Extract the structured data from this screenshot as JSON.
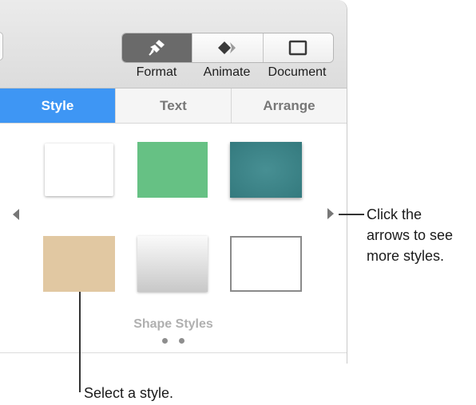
{
  "toolbar": {
    "buttons": [
      {
        "label": "Format",
        "icon": "paintbrush-icon",
        "active": true
      },
      {
        "label": "Animate",
        "icon": "diamond-arrow-icon",
        "active": false
      },
      {
        "label": "Document",
        "icon": "document-rect-icon",
        "active": false
      }
    ]
  },
  "tabs": [
    {
      "label": "Style",
      "active": true
    },
    {
      "label": "Text",
      "active": false
    },
    {
      "label": "Arrange",
      "active": false
    }
  ],
  "styles": {
    "swatches": [
      {
        "name": "white-paper",
        "color": "#ffffff"
      },
      {
        "name": "green",
        "color": "#66c184"
      },
      {
        "name": "teal-texture",
        "color": "#3f8488"
      },
      {
        "name": "tan",
        "color": "#e1c8a2"
      },
      {
        "name": "gray-gradient",
        "color": "#e0e0e0"
      },
      {
        "name": "white-outline",
        "color": "#ffffff"
      }
    ],
    "caption": "Shape Styles",
    "page_count": 2
  },
  "callouts": {
    "arrows_text": [
      "Click the",
      "arrows to see",
      "more styles."
    ],
    "select_text": "Select a style."
  },
  "colors": {
    "accent": "#3e96f4",
    "active_toolbar": "#6a6a6a"
  }
}
